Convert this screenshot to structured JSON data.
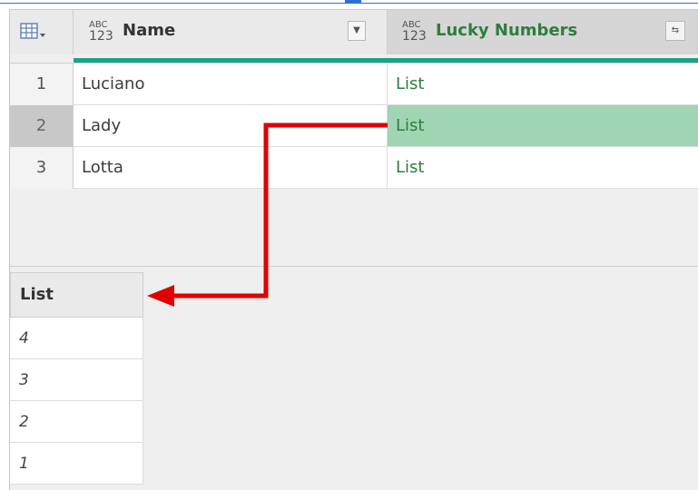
{
  "grid": {
    "columns": [
      {
        "type_top": "ABC",
        "type_bottom": "123",
        "label": "Name"
      },
      {
        "type_top": "ABC",
        "type_bottom": "123",
        "label": "Lucky Numbers"
      }
    ],
    "rows": [
      {
        "num": "1",
        "name": "Luciano",
        "lucky": "List",
        "selected": false
      },
      {
        "num": "2",
        "name": "Lady",
        "lucky": "List",
        "selected": true
      },
      {
        "num": "3",
        "name": "Lotta",
        "lucky": "List",
        "selected": false
      }
    ]
  },
  "preview": {
    "header": "List",
    "values": [
      "4",
      "3",
      "2",
      "1"
    ]
  },
  "colors": {
    "accent_teal": "#1aa38a",
    "list_text": "#2e7d3f",
    "selected_cell": "#9fd5b3",
    "arrow": "#e00000"
  },
  "icons": [
    "table-menu-icon",
    "dropdown-arrow-icon",
    "expand-column-icon",
    "type-any-icon"
  ]
}
